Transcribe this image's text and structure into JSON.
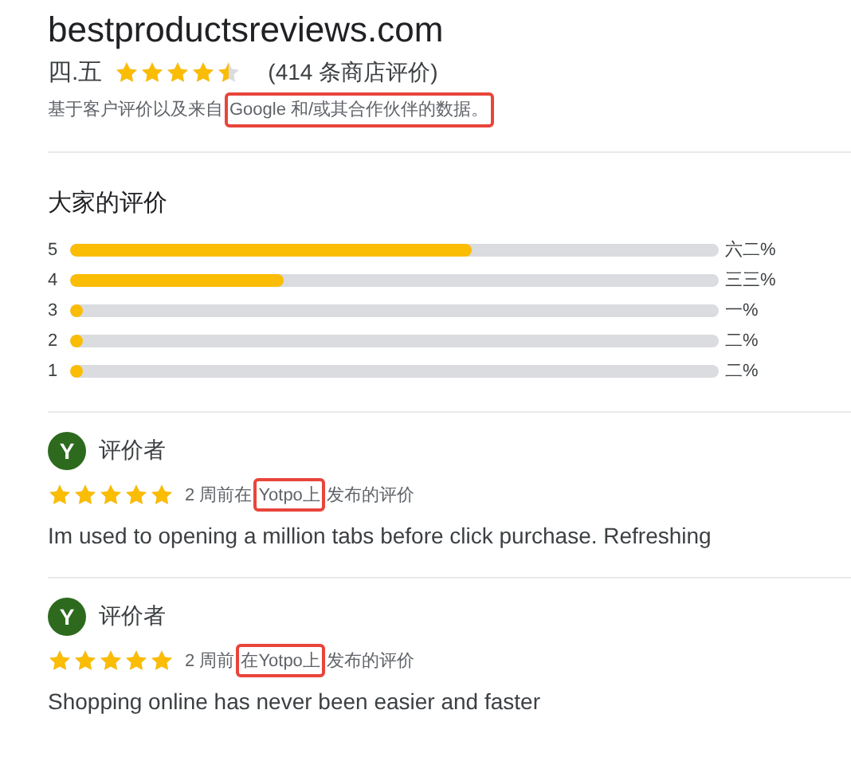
{
  "site": {
    "title": "bestproductsreviews.com",
    "rating": "四.五",
    "stars": 4.5,
    "review_count": "(414 条商店评价)",
    "source_note": [
      {
        "text": "基于客户评价以及来自",
        "highlight": false
      },
      {
        "text": "Google 和/或其合作伙伴的数据。",
        "highlight": true
      }
    ]
  },
  "summary": {
    "title": "大家的评价",
    "rows": [
      {
        "label": "5",
        "level": 0.62,
        "percent": "六二%"
      },
      {
        "label": "4",
        "level": 0.33,
        "percent": "三三%"
      },
      {
        "label": "3",
        "level": 0.01,
        "percent": "一%"
      },
      {
        "label": "2",
        "level": 0.02,
        "percent": "二%"
      },
      {
        "label": "1",
        "level": 0.02,
        "percent": "二%"
      }
    ]
  },
  "reviews": [
    {
      "initial": "Y",
      "name": "评价者",
      "stars": 5,
      "meta": [
        {
          "text": "2 周前在",
          "highlight": false
        },
        {
          "text": "Yotpo上",
          "highlight": true
        },
        {
          "text": "发布的评价",
          "highlight": false
        }
      ],
      "text": "Im used to opening a million tabs before click purchase. Refreshing"
    },
    {
      "initial": "Y",
      "name": "评价者",
      "stars": 5,
      "meta": [
        {
          "text": "2 周前",
          "highlight": false
        },
        {
          "text": "在Yotpo上",
          "highlight": true
        },
        {
          "text": "发布的评价",
          "highlight": false
        }
      ],
      "text": "Shopping online has never been easier and faster"
    }
  ]
}
